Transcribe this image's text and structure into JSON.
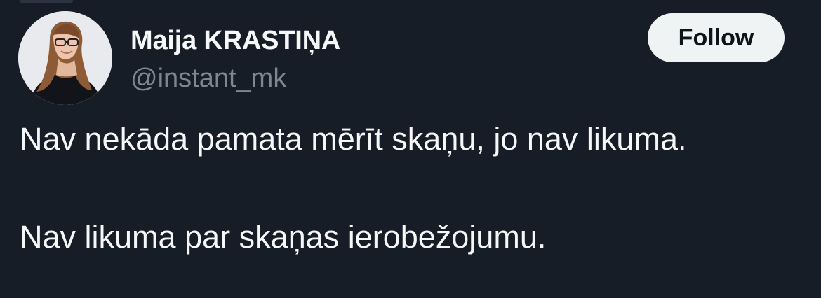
{
  "tweet": {
    "author": {
      "display_name": "Maija KRASTIŅA",
      "handle": "@instant_mk"
    },
    "follow_label": "Follow",
    "body": [
      "Nav nekāda pamata mērīt skaņu, jo nav likuma.",
      "Nav likuma par skaņas ierobežojumu."
    ]
  },
  "colors": {
    "background": "#161d27",
    "primary_text": "#f5f7f9",
    "secondary_text": "#7d8791",
    "follow_button_bg": "#eff3f4",
    "follow_button_text": "#0f1419"
  },
  "icons": {
    "avatar": "profile-photo"
  }
}
